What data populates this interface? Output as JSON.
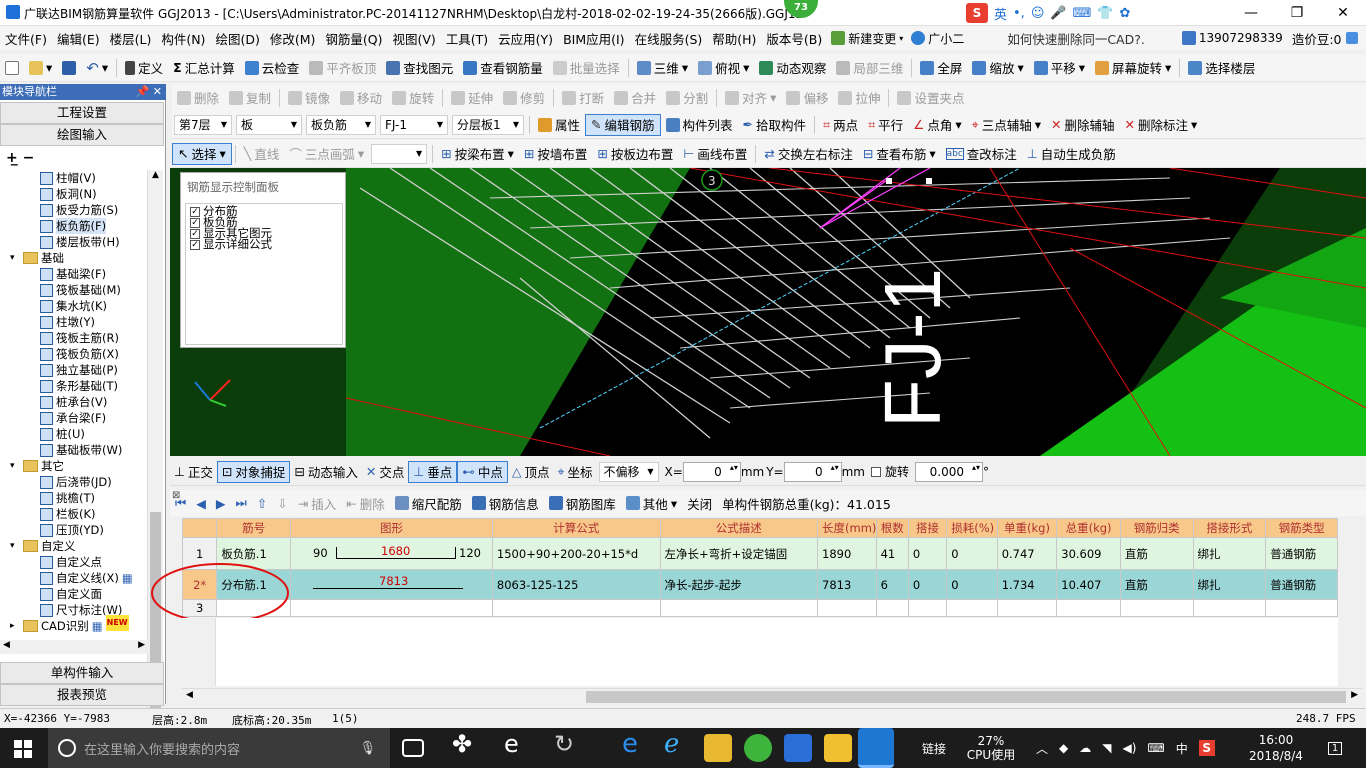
{
  "titlebar": {
    "title": "广联达BIM钢筋算量软件 GGJ2013 - [C:\\Users\\Administrator.PC-20141127NRHM\\Desktop\\白龙村-2018-02-02-19-24-35(2666版).GGJ12",
    "badge": "73",
    "ime_label": "英",
    "min": "—",
    "max": "❐",
    "close": "✕"
  },
  "menu": {
    "items": [
      "文件(F)",
      "编辑(E)",
      "楼层(L)",
      "构件(N)",
      "绘图(D)",
      "修改(M)",
      "钢筋量(Q)",
      "视图(V)",
      "工具(T)",
      "云应用(Y)",
      "BIM应用(I)",
      "在线服务(S)",
      "帮助(H)",
      "版本号(B)"
    ],
    "new_change": "新建变更",
    "assistant": "广小二",
    "question": "如何快速删除同一CAD?.",
    "phone": "13907298339",
    "price": "造价豆:0"
  },
  "toolbar1": {
    "items": [
      "定义",
      "汇总计算",
      "云检查",
      "平齐板顶",
      "查找图元",
      "查看钢筋量",
      "批量选择",
      "三维",
      "俯视",
      "动态观察",
      "局部三维",
      "全屏",
      "缩放",
      "平移",
      "屏幕旋转",
      "选择楼层"
    ]
  },
  "toolbar2": {
    "items": [
      "删除",
      "复制",
      "镜像",
      "移动",
      "旋转",
      "延伸",
      "修剪",
      "打断",
      "合并",
      "分割",
      "对齐",
      "偏移",
      "拉伸",
      "设置夹点"
    ]
  },
  "toolbar3": {
    "floor": "第7层",
    "type": "板",
    "subtype": "板负筋",
    "member": "FJ-1",
    "layer": "分层板1",
    "items": [
      "属性",
      "编辑钢筋",
      "构件列表",
      "拾取构件",
      "两点",
      "平行",
      "点角",
      "三点辅轴",
      "删除辅轴",
      "删除标注"
    ]
  },
  "toolbar4": {
    "items": [
      "选择",
      "直线",
      "三点画弧",
      "按梁布置",
      "按墙布置",
      "按板边布置",
      "画线布置",
      "交换左右标注",
      "查看布筋",
      "查改标注",
      "自动生成负筋"
    ]
  },
  "leftpanel": {
    "header": "模块导航栏",
    "pin": "📌 ✕",
    "btn1": "工程设置",
    "btn2": "绘图输入",
    "btn3": "单构件输入",
    "btn4": "报表预览",
    "tree": [
      {
        "label": "柱帽(V)",
        "kind": "item"
      },
      {
        "label": "板洞(N)",
        "kind": "item"
      },
      {
        "label": "板受力筋(S)",
        "kind": "item"
      },
      {
        "label": "板负筋(F)",
        "kind": "item"
      },
      {
        "label": "楼层板带(H)",
        "kind": "item"
      },
      {
        "label": "基础",
        "kind": "folder"
      },
      {
        "label": "基础梁(F)",
        "kind": "item"
      },
      {
        "label": "筏板基础(M)",
        "kind": "item"
      },
      {
        "label": "集水坑(K)",
        "kind": "item"
      },
      {
        "label": "柱墩(Y)",
        "kind": "item"
      },
      {
        "label": "筏板主筋(R)",
        "kind": "item"
      },
      {
        "label": "筏板负筋(X)",
        "kind": "item"
      },
      {
        "label": "独立基础(P)",
        "kind": "item"
      },
      {
        "label": "条形基础(T)",
        "kind": "item"
      },
      {
        "label": "桩承台(V)",
        "kind": "item"
      },
      {
        "label": "承台梁(F)",
        "kind": "item"
      },
      {
        "label": "桩(U)",
        "kind": "item"
      },
      {
        "label": "基础板带(W)",
        "kind": "item"
      },
      {
        "label": "其它",
        "kind": "folder"
      },
      {
        "label": "后浇带(JD)",
        "kind": "item"
      },
      {
        "label": "挑檐(T)",
        "kind": "item"
      },
      {
        "label": "栏板(K)",
        "kind": "item"
      },
      {
        "label": "压顶(YD)",
        "kind": "item"
      },
      {
        "label": "自定义",
        "kind": "folder"
      },
      {
        "label": "自定义点",
        "kind": "item"
      },
      {
        "label": "自定义线(X)",
        "kind": "item"
      },
      {
        "label": "自定义面",
        "kind": "item"
      },
      {
        "label": "尺寸标注(W)",
        "kind": "item"
      },
      {
        "label": "CAD识别",
        "kind": "folder"
      }
    ],
    "new_badge": "NEW"
  },
  "viewport": {
    "panel_title": "钢筋显示控制面板",
    "checks": [
      "分布筋",
      "板负筋",
      "显示其它图元",
      "显示详细公式"
    ],
    "marker": "3",
    "big_label": "FJ-1"
  },
  "snapbar": {
    "items": [
      "正交",
      "对象捕捉",
      "动态输入",
      "交点",
      "垂点",
      "中点",
      "顶点",
      "坐标"
    ],
    "offset": "不偏移",
    "x_label": "X=",
    "x_val": "0",
    "y_label": "Y=",
    "y_val": "0",
    "unit": "mm",
    "rotate": "旋转",
    "rot_val": "0.000",
    "deg": "°"
  },
  "rebarbar": {
    "items": [
      "插入",
      "删除",
      "缩尺配筋",
      "钢筋信息",
      "钢筋图库",
      "其他",
      "关闭"
    ],
    "total": "单构件钢筋总重(kg)：41.015"
  },
  "grid": {
    "headers": [
      "筋号",
      "图形",
      "计算公式",
      "公式描述",
      "长度(mm)",
      "根数",
      "搭接",
      "损耗(%)",
      "单重(kg)",
      "总重(kg)",
      "钢筋归类",
      "搭接形式",
      "钢筋类型"
    ],
    "rows": [
      {
        "idx": "1",
        "name": "板负筋.1",
        "fig_left": "90",
        "fig_mid": "1680",
        "fig_right": "120",
        "formula": "1500+90+200-20+15*d",
        "desc": "左净长+弯折+设定锚固",
        "len": "1890",
        "count": "41",
        "lap": "0",
        "loss": "0",
        "unit_w": "0.747",
        "total_w": "30.609",
        "cls": "直筋",
        "lap_type": "绑扎",
        "type": "普通钢筋"
      },
      {
        "idx": "2*",
        "name": "分布筋.1",
        "fig_mid": "7813",
        "formula": "8063-125-125",
        "desc": "净长-起步-起步",
        "len": "7813",
        "count": "6",
        "lap": "0",
        "loss": "0",
        "unit_w": "1.734",
        "total_w": "10.407",
        "cls": "直筋",
        "lap_type": "绑扎",
        "type": "普通钢筋"
      },
      {
        "idx": "3"
      }
    ]
  },
  "status": {
    "coords": "X=-42366 Y=-7983",
    "floor_h": "层高:2.8m",
    "base_h": "底标高:20.35m",
    "count": "1(5)",
    "fps": "248.7 FPS"
  },
  "taskbar": {
    "search": "在这里输入你要搜索的内容",
    "link": "链接",
    "cpu_pct": "27%",
    "cpu": "CPU使用",
    "lang": "中",
    "time": "16:00",
    "date": "2018/8/4",
    "notif": "1"
  },
  "colors": {
    "title_blue": "#3d6db7",
    "grid_header": "#f7c88a",
    "row_green": "#dff5df",
    "row_cyan": "#9bd6d6",
    "annot_red": "#e01010"
  }
}
